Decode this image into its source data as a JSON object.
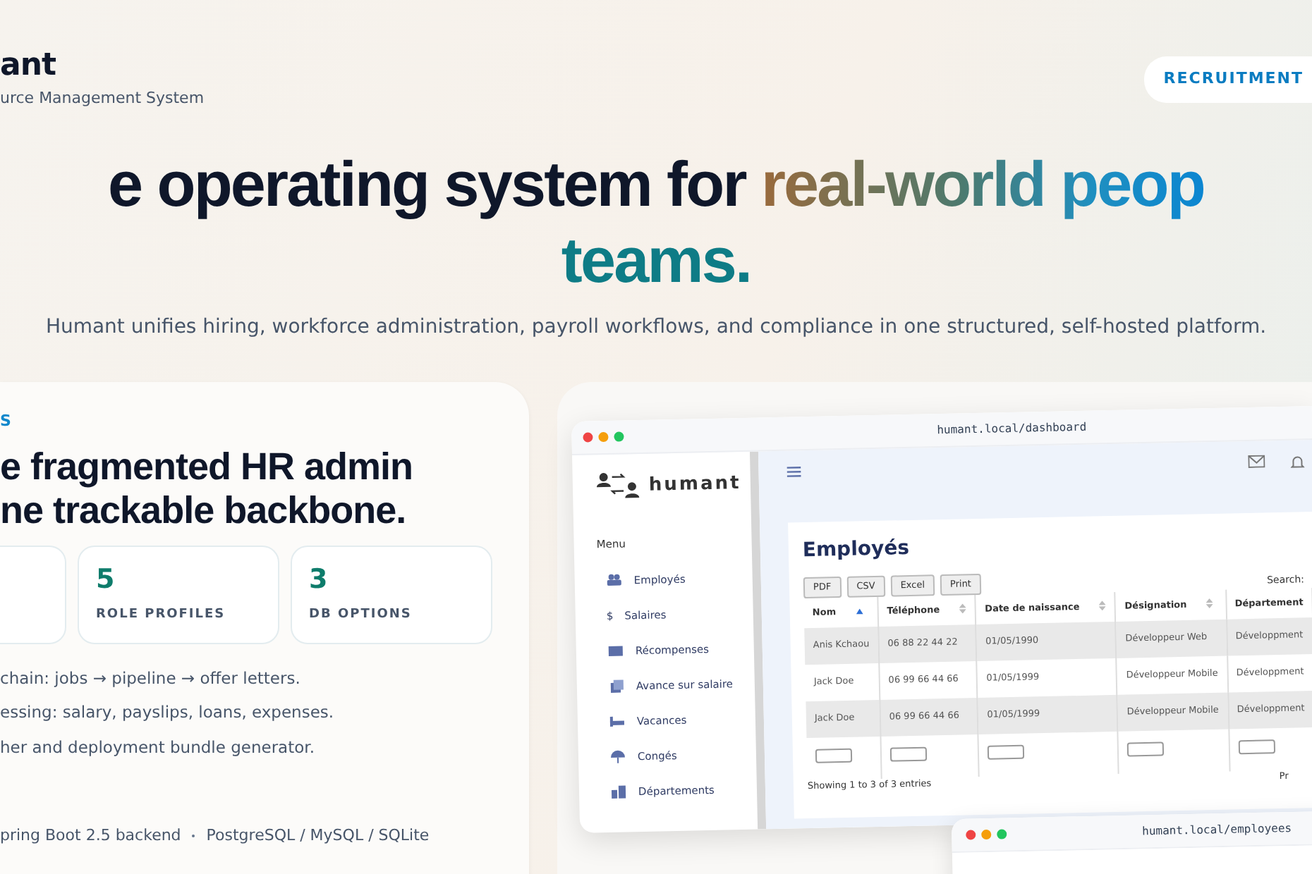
{
  "brand": {
    "name": "ant",
    "tagline": "urce Management System"
  },
  "nav_pill": "RECRUITMENT",
  "hero": {
    "headline_parts": [
      {
        "text": "e operating system for ",
        "kind": "plain"
      },
      {
        "text": "real-world peop",
        "kind": "gradient"
      }
    ],
    "headline_line2": "teams.",
    "subtitle": "Humant unifies hiring, workforce administration, payroll workflows, and compliance in one structured, self-hosted platform."
  },
  "feature_card": {
    "eyebrow": "S",
    "title_lines": [
      "e fragmented HR admin",
      "ne trackable backbone."
    ],
    "stats": [
      {
        "kind": "hidden"
      },
      {
        "kind": "stat",
        "value": "5",
        "label": "ROLE PROFILES"
      },
      {
        "kind": "stat",
        "value": "3",
        "label": "DB OPTIONS"
      }
    ],
    "bullets": [
      "chain: jobs → pipeline → offer letters.",
      "essing: salary, payslips, loans, expenses.",
      "her and deployment bundle generator."
    ],
    "footer": [
      "pring Boot 2.5 backend",
      "PostgreSQL / MySQL / SQLite"
    ]
  },
  "mockup": {
    "url": "humant.local/dashboard",
    "logo": "humant",
    "menu_title": "Menu",
    "menu": [
      {
        "label": "Employés",
        "kind": "people"
      },
      {
        "label": "Salaires",
        "kind": "glyph",
        "glyph": "$"
      },
      {
        "label": "Récompenses",
        "kind": "card"
      },
      {
        "label": "Avance sur salaire",
        "kind": "doc"
      },
      {
        "label": "Vacances",
        "kind": "bed"
      },
      {
        "label": "Congés",
        "kind": "umbrella"
      },
      {
        "label": "Départements",
        "kind": "building"
      }
    ],
    "page_title": "Employés",
    "export_buttons": [
      "PDF",
      "CSV",
      "Excel",
      "Print"
    ],
    "search_label": "Search:",
    "columns": [
      {
        "label": "Nom",
        "kind": "sorted"
      },
      {
        "label": "Téléphone",
        "kind": "sortable"
      },
      {
        "label": "Date de naissance",
        "kind": "sortable"
      },
      {
        "label": "Désignation",
        "kind": "sortable"
      },
      {
        "label": "Département",
        "kind": "plain"
      }
    ],
    "rows": [
      [
        "Anis Kchaou",
        "06 88 22 44 22",
        "01/05/1990",
        "Développeur Web",
        "Développment"
      ],
      [
        "Jack Doe",
        "06 99 66 44 66",
        "01/05/1999",
        "Développeur Mobile",
        "Développment"
      ],
      [
        "Jack Doe",
        "06 99 66 44 66",
        "01/05/1999",
        "Développeur Mobile",
        "Développment"
      ]
    ],
    "info": "Showing 1 to 3 of 3 entries",
    "pager": "Pr"
  },
  "second_window": {
    "url": "humant.local/employees"
  }
}
